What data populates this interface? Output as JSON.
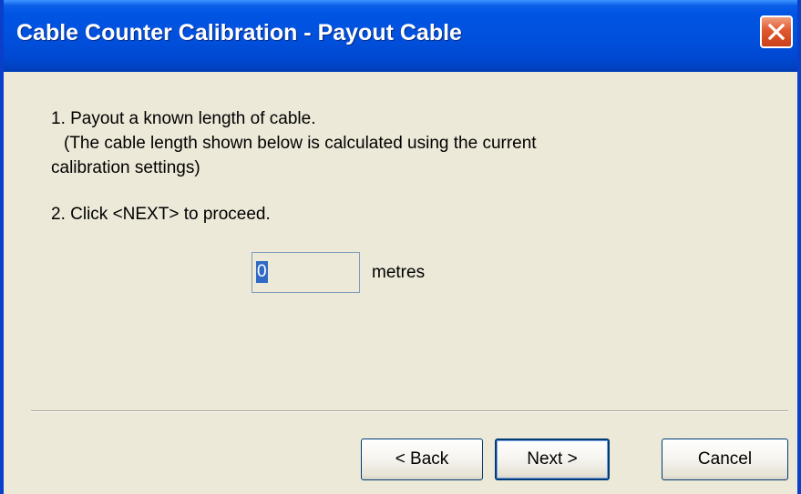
{
  "window": {
    "title": "Cable Counter Calibration - Payout Cable"
  },
  "instructions": {
    "step1_line1": "1. Payout a known length of cable.",
    "step1_line2": "(The cable length shown below is calculated using the current",
    "step1_line3": "calibration settings)",
    "step2": "2. Click <NEXT> to proceed."
  },
  "length_field": {
    "value": "0",
    "unit_label": "metres"
  },
  "buttons": {
    "back": "< Back",
    "next": "Next >",
    "cancel": "Cancel"
  },
  "icons": {
    "close": "close-icon"
  },
  "colors": {
    "titlebar": "#0054e3",
    "close_button": "#e0582e",
    "dialog_background": "#ece9d8",
    "selection": "#316ac5"
  }
}
